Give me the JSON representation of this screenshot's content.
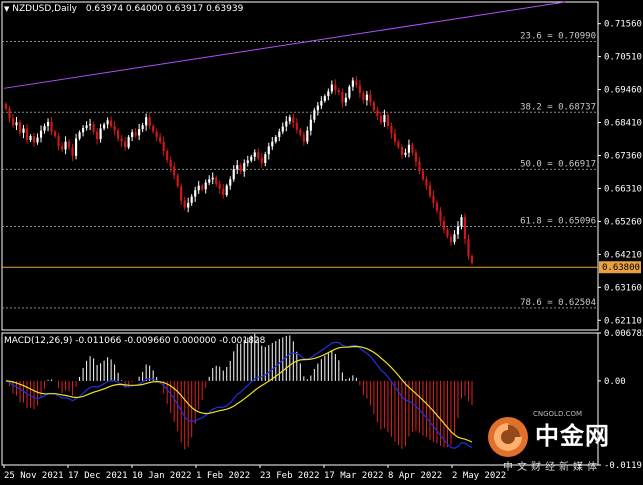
{
  "header": {
    "symbol": "NZDUSD,Daily",
    "ohlc": "0.63974 0.64000 0.63917 0.63939"
  },
  "macd": {
    "label": "MACD(12,26,9) -0.011066 -0.009660 0.000000 -0.001828",
    "axis_labels": [
      "0.006785",
      "0.00",
      "-0.011916"
    ],
    "axis_values": [
      0.006785,
      0.0,
      -0.011916
    ]
  },
  "watermark": {
    "brand": "中金网",
    "url": "CNGOLD.COM",
    "tagline": "中文财经新媒体"
  },
  "colors": {
    "background": "#000000",
    "bull": "#ffffff",
    "bear": "#d01818",
    "trendline": "#b050ff",
    "fib": "#8a8a8a",
    "price_line": "#e8a040",
    "macd_line": "#2030e0",
    "signal_line": "#f0e020",
    "hist_pos": "#ffffff",
    "hist_neg": "#e02020"
  },
  "chart_data": {
    "type": "candlestick",
    "price_axis": {
      "ticks": [
        0.7156,
        0.7051,
        0.6946,
        0.6841,
        0.6736,
        0.6631,
        0.6526,
        0.6421,
        0.6316,
        0.6211
      ],
      "tick_labels": [
        "0.71560",
        "0.70510",
        "0.69460",
        "0.68410",
        "0.67360",
        "0.66310",
        "0.65260",
        "0.64210",
        "0.63160",
        "0.62110"
      ],
      "current_price": 0.638,
      "current_price_label": "0.63800",
      "ylim": [
        0.618,
        0.7225
      ]
    },
    "x_labels": [
      "25 Nov 2021",
      "17 Dec 2021",
      "10 Jan 2022",
      "1 Feb 2022",
      "23 Feb 2022",
      "17 Mar 2022",
      "8 Apr 2022",
      "2 May 2022"
    ],
    "fib_levels": [
      {
        "label": "23.6 = 0.70990",
        "value": 0.7099
      },
      {
        "label": "38.2 = 0.68737",
        "value": 0.68737
      },
      {
        "label": "50.0 = 0.66917",
        "value": 0.66917
      },
      {
        "label": "61.8 = 0.65096",
        "value": 0.65096
      },
      {
        "label": "78.6 = 0.62504",
        "value": 0.62504
      }
    ],
    "trendline": {
      "start": 0.695,
      "end": 0.7225
    },
    "closes": [
      0.6885,
      0.6855,
      0.6832,
      0.6842,
      0.6808,
      0.6822,
      0.6785,
      0.6798,
      0.6778,
      0.6793,
      0.6815,
      0.683,
      0.6843,
      0.6812,
      0.6798,
      0.6765,
      0.6755,
      0.678,
      0.6762,
      0.6735,
      0.679,
      0.681,
      0.6823,
      0.6832,
      0.6836,
      0.6812,
      0.6788,
      0.6822,
      0.6835,
      0.6848,
      0.683,
      0.6815,
      0.679,
      0.678,
      0.6762,
      0.6795,
      0.681,
      0.68,
      0.682,
      0.6832,
      0.6858,
      0.683,
      0.6812,
      0.6795,
      0.678,
      0.675,
      0.6722,
      0.67,
      0.6672,
      0.6638,
      0.6592,
      0.657,
      0.6585,
      0.6605,
      0.6625,
      0.664,
      0.6628,
      0.665,
      0.666,
      0.6665,
      0.6645,
      0.663,
      0.661,
      0.664,
      0.666,
      0.6692,
      0.6705,
      0.6685,
      0.6712,
      0.672,
      0.6732,
      0.6746,
      0.6728,
      0.6712,
      0.674,
      0.6765,
      0.678,
      0.6795,
      0.6812,
      0.6828,
      0.6845,
      0.6858,
      0.684,
      0.6818,
      0.6802,
      0.678,
      0.6815,
      0.685,
      0.688,
      0.6895,
      0.691,
      0.6925,
      0.694,
      0.6962,
      0.6945,
      0.6938,
      0.6905,
      0.692,
      0.6955,
      0.6975,
      0.696,
      0.6935,
      0.6912,
      0.693,
      0.6905,
      0.688,
      0.6862,
      0.6842,
      0.6865,
      0.683,
      0.6806,
      0.678,
      0.6762,
      0.6738,
      0.6745,
      0.677,
      0.6745,
      0.6716,
      0.6686,
      0.666,
      0.664,
      0.6608,
      0.6585,
      0.656,
      0.6527,
      0.65,
      0.6478,
      0.646,
      0.6485,
      0.651,
      0.654,
      0.647,
      0.6415,
      0.6394
    ]
  }
}
